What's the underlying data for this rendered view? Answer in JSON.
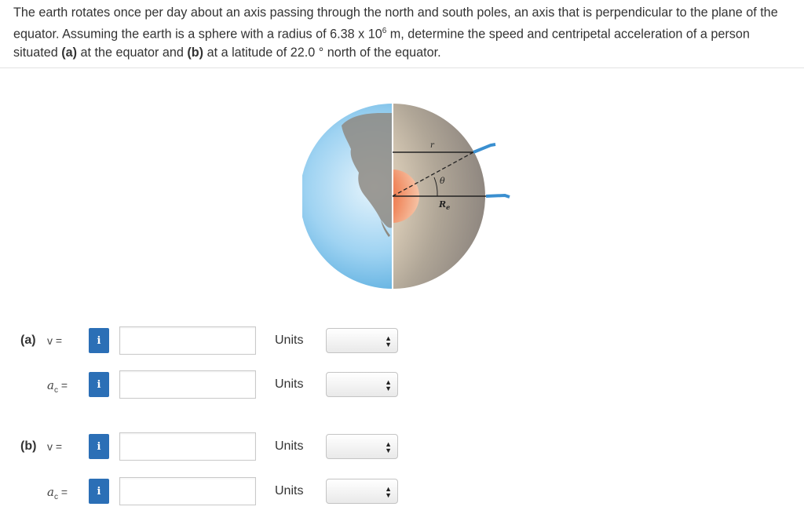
{
  "problem": {
    "text_1": "The earth rotates once per day about an axis passing through the north and south poles, an axis that is perpendicular to the plane of the equator. Assuming the earth is a sphere with a radius of 6.38 x 10",
    "exponent": "6",
    "text_2": " m, determine the speed and centripetal acceleration of a person situated ",
    "part_a_tag": "(a)",
    "text_3": " at the equator and ",
    "part_b_tag": "(b)",
    "text_4": " at a latitude of 22.0 ° north of the equator."
  },
  "figure": {
    "label_r": "r",
    "label_theta": "θ",
    "label_Re": "R",
    "label_Re_sub": "e"
  },
  "rows": [
    {
      "part": "(a)",
      "var": "v =",
      "var_symbol": "",
      "var_sub": "",
      "info": "i",
      "value": "",
      "units_label": "Units",
      "units_value": ""
    },
    {
      "part": "",
      "var": "=",
      "var_symbol": "a",
      "var_sub": "c",
      "info": "i",
      "value": "",
      "units_label": "Units",
      "units_value": ""
    },
    {
      "part": "(b)",
      "var": "v =",
      "var_symbol": "",
      "var_sub": "",
      "info": "i",
      "value": "",
      "units_label": "Units",
      "units_value": ""
    },
    {
      "part": "",
      "var": "=",
      "var_symbol": "a",
      "var_sub": "c",
      "info": "i",
      "value": "",
      "units_label": "Units",
      "units_value": ""
    }
  ],
  "colors": {
    "info_button": "#2b6fb6",
    "ocean": "#8cc8ee",
    "mantle": "#a89f95",
    "core": "#e8663f"
  }
}
